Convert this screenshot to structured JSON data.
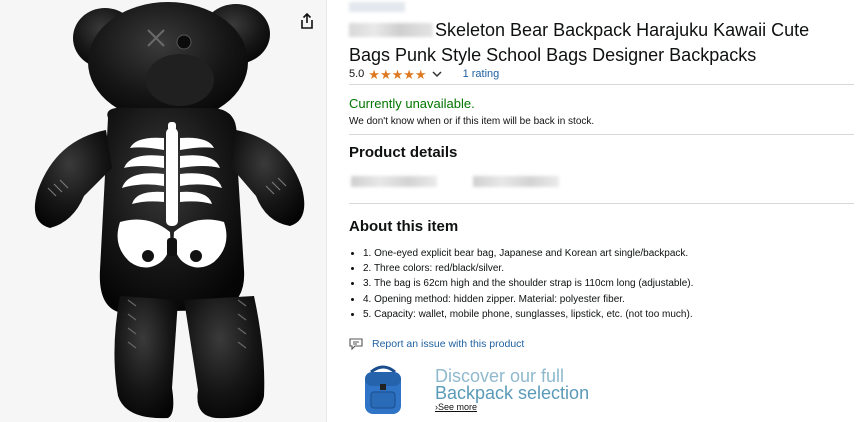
{
  "product": {
    "title": "Skeleton Bear Backpack Harajuku Kawaii Cute Bags Punk Style School Bags Designer Backpacks",
    "rating_score": "5.0",
    "stars": 5,
    "rating_count_label": "1 rating"
  },
  "availability": {
    "status": "Currently unavailable.",
    "note": "We don't know when or if this item will be back in stock."
  },
  "sections": {
    "product_details": "Product details",
    "about": "About this item"
  },
  "about_items": [
    "1. One-eyed explicit bear bag, Japanese and Korean art single/backpack.",
    "2. Three colors: red/black/silver.",
    "3. The bag is 62cm high and the shoulder strap is 110cm long (adjustable).",
    "4. Opening method: hidden zipper. Material: polyester fiber.",
    "5. Capacity: wallet, mobile phone, sunglasses, lipstick, etc. (not too much)."
  ],
  "report": {
    "label": "Report an issue with this product"
  },
  "discover": {
    "line1": "Discover our full",
    "line2": "Backpack selection",
    "see_more": "›See more"
  },
  "colors": {
    "available_green": "#007600",
    "link_blue": "#2162a1",
    "star_orange": "#de7921",
    "discover_blue": "#5a9ab8"
  },
  "icons": {
    "share": "share-icon",
    "chevron": "chevron-down-icon",
    "report": "report-icon",
    "backpack": "backpack-icon"
  }
}
